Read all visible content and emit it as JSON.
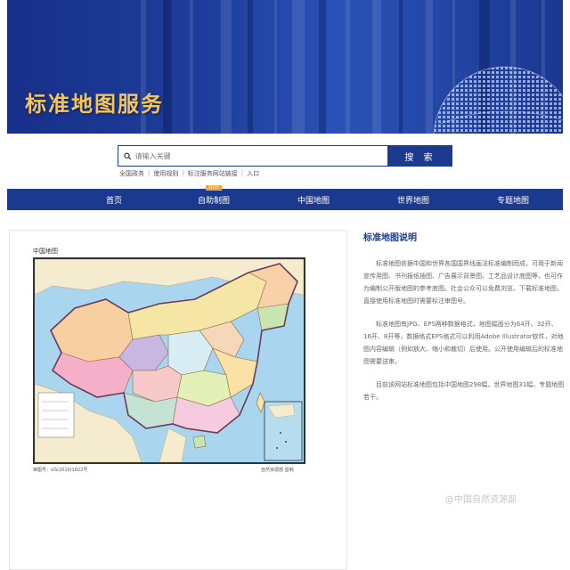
{
  "banner": {
    "title": "标准地图服务"
  },
  "search": {
    "placeholder": "请输入关键",
    "button_label": "搜 索"
  },
  "quick_links": [
    "全国政务",
    "使用规则",
    "标注服务网站链接",
    "入口"
  ],
  "nav": {
    "items": [
      {
        "label": "首页",
        "badge": ""
      },
      {
        "label": "自助制图",
        "badge": "HOT"
      },
      {
        "label": "中国地图",
        "badge": ""
      },
      {
        "label": "世界地图",
        "badge": ""
      },
      {
        "label": "专题地图",
        "badge": ""
      }
    ]
  },
  "map_panel": {
    "title": "中国地图",
    "caption_left": "审图号：GS(2019)1822号",
    "caption_right": "自然资源部 监制"
  },
  "article": {
    "heading": "标准地图说明",
    "paragraphs": [
      "标准地图依据中国和世界各国国界线画法标准编制而成，可用于新闻宣传用图、书刊报纸插图、广告展示背景图、工艺品设计底图等，也可作为编制公开版地图的参考底图。社会公众可以免费浏览、下载标准地图，直接使用标准地图时需要标注审图号。",
      "标准地图有JPG、EPS两种数据格式，地图幅面分为64开、32开、16开、8开等，数据格式EPS格式可以利用Adobe Illustrator软件，对地图内容编辑（例如放大、缩小和裁切）后使用。公开使用编辑后的标准地图需要送审。",
      "目前该网站标准地图包括中国地图298幅，世界地图31幅，专题地图若干。"
    ]
  },
  "watermark": "@中国自然资源部",
  "colors": {
    "brand_blue": "#1b3a8f",
    "accent_gold": "#f4c65a",
    "badge_orange": "#f0a23a",
    "sea": "#a9d6ee"
  }
}
